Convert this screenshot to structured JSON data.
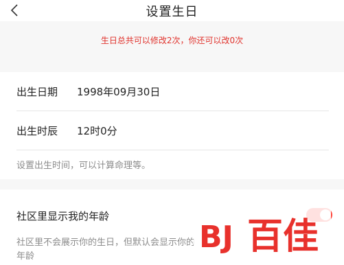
{
  "header": {
    "title": "设置生日",
    "back_icon": "chevron-left-icon"
  },
  "notice": {
    "text": "生日总共可以修改2次，你还可以改0次",
    "color": "#e0312b"
  },
  "birth": {
    "date_label": "出生日期",
    "date_value": "1998年09月30日",
    "time_label": "出生时辰",
    "time_value": "12时0分",
    "hint": "设置出生时间，可以计算命理等。"
  },
  "community": {
    "title": "社区里显示我的年龄",
    "desc": "社区里不会展示你的生日，但默认会显示你的年龄",
    "toggle_on": true
  },
  "watermark": {
    "text": "BJ百佳",
    "color": "#e8312c"
  }
}
